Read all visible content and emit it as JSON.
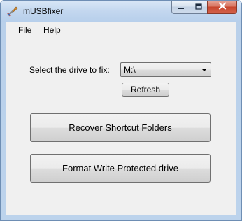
{
  "window": {
    "title": "mUSBfixer",
    "app_icon": "usb-app-icon"
  },
  "caption": {
    "minimize_icon": "minimize-icon",
    "maximize_icon": "maximize-icon",
    "close_icon": "close-icon"
  },
  "menu": {
    "items": [
      {
        "label": "File"
      },
      {
        "label": "Help"
      }
    ]
  },
  "drive": {
    "label": "Select the drive to fix:",
    "selected": "M:\\",
    "refresh_label": "Refresh"
  },
  "actions": {
    "recover_label": "Recover Shortcut Folders",
    "format_label": "Format Write Protected drive"
  },
  "colors": {
    "close_button": "#c7452c",
    "window_frame": "#b9d0ea",
    "client_background": "#f0f0f0"
  }
}
